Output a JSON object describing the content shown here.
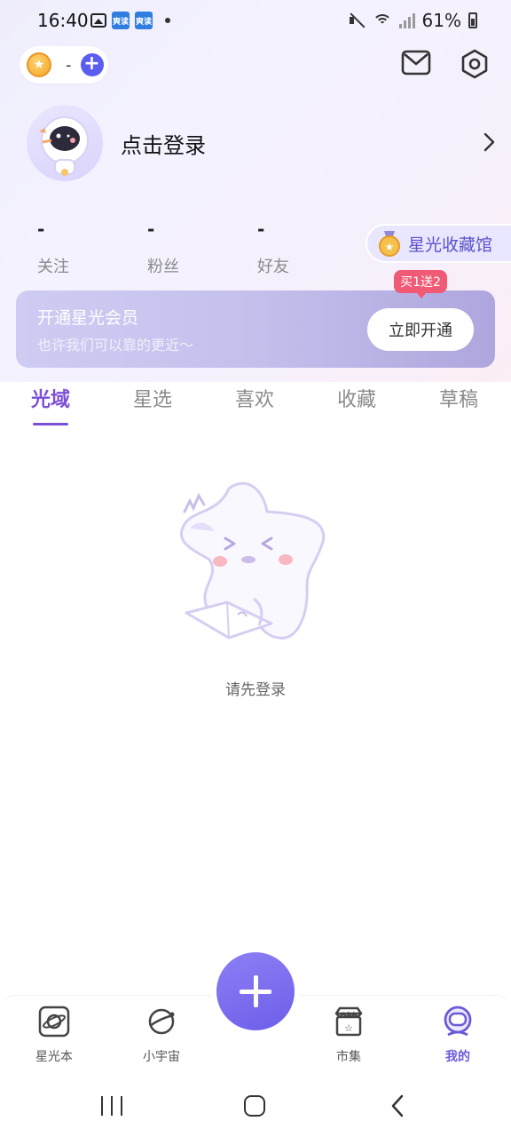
{
  "status_bar": {
    "time": "16:40",
    "battery": "61%",
    "app_icon_text": "爽读"
  },
  "top_bar": {
    "coin_value": "-",
    "add_label": "+"
  },
  "profile": {
    "login_label": "点击登录"
  },
  "stats": [
    {
      "value": "-",
      "label": "关注"
    },
    {
      "value": "-",
      "label": "粉丝"
    },
    {
      "value": "-",
      "label": "好友"
    }
  ],
  "museum": {
    "label": "星光收藏馆"
  },
  "vip": {
    "title": "开通星光会员",
    "subtitle": "也许我们可以靠的更近～",
    "button": "立即开通",
    "promo": "买1送2"
  },
  "tabs": [
    {
      "label": "光域",
      "active": true
    },
    {
      "label": "星选",
      "active": false
    },
    {
      "label": "喜欢",
      "active": false
    },
    {
      "label": "收藏",
      "active": false
    },
    {
      "label": "草稿",
      "active": false
    }
  ],
  "empty_state": {
    "message": "请先登录"
  },
  "bottom_nav": [
    {
      "label": "星光本",
      "icon": "planet-book-icon",
      "active": false
    },
    {
      "label": "小宇宙",
      "icon": "planet-icon",
      "active": false
    },
    {
      "label": "市集",
      "icon": "store-icon",
      "active": false
    },
    {
      "label": "我的",
      "icon": "astronaut-icon",
      "active": true
    }
  ],
  "colors": {
    "accent": "#7b4fd8",
    "fab": "#7a6bef",
    "promo": "#f05a74",
    "museum_text": "#5a52c9"
  }
}
